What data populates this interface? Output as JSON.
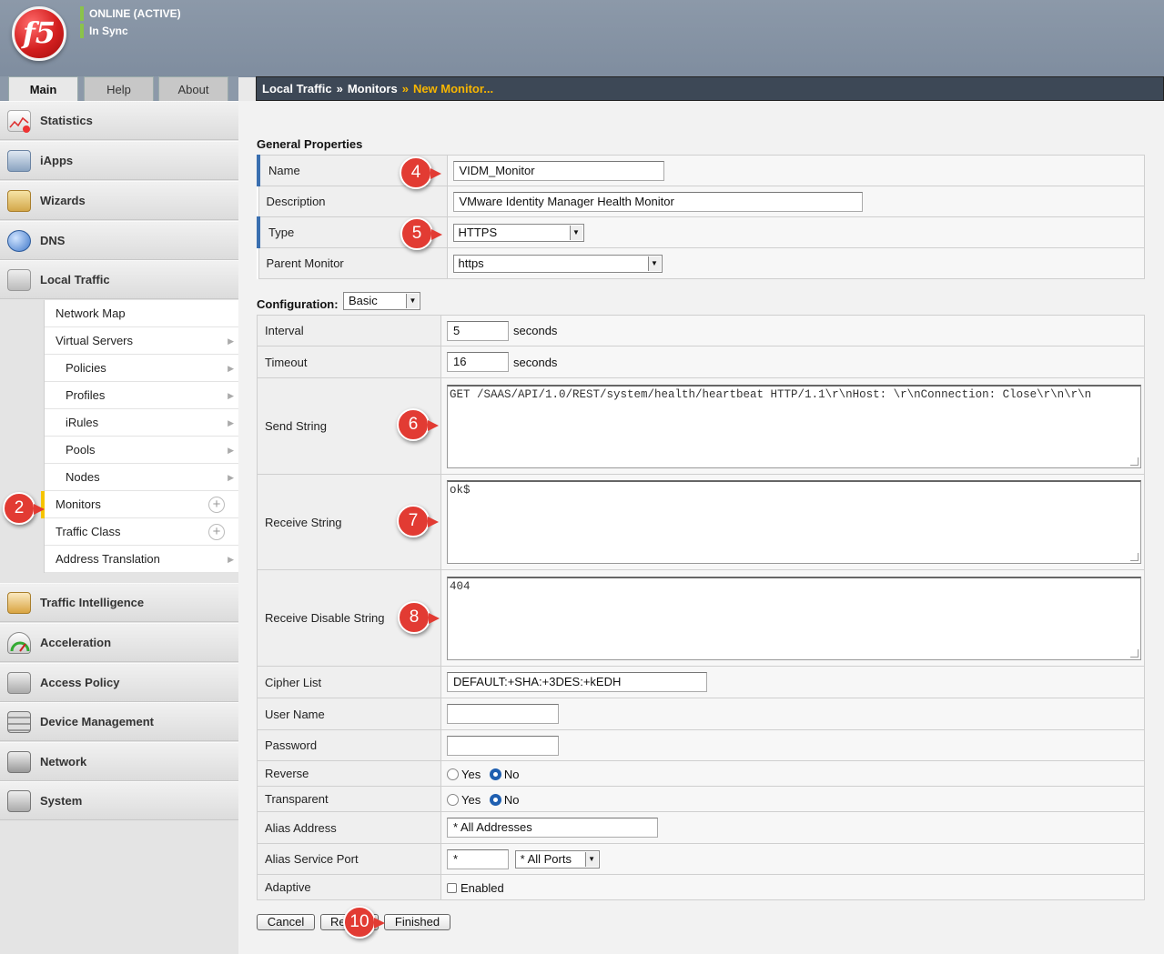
{
  "header": {
    "logo": "f5",
    "status_online": "ONLINE (ACTIVE)",
    "status_sync": "In Sync"
  },
  "tabs": [
    "Main",
    "Help",
    "About"
  ],
  "breadcrumb": {
    "items": [
      "Local Traffic",
      "Monitors"
    ],
    "current": "New Monitor..."
  },
  "sidebar": {
    "items": [
      {
        "label": "Statistics",
        "icon": "statistics-icon"
      },
      {
        "label": "iApps",
        "icon": "iapps-icon"
      },
      {
        "label": "Wizards",
        "icon": "wizards-icon"
      },
      {
        "label": "DNS",
        "icon": "dns-globe-icon"
      },
      {
        "label": "Local Traffic",
        "icon": "local-traffic-icon"
      },
      {
        "label": "Traffic Intelligence",
        "icon": "traffic-intelligence-icon"
      },
      {
        "label": "Acceleration",
        "icon": "acceleration-gauge-icon"
      },
      {
        "label": "Access Policy",
        "icon": "access-policy-icon"
      },
      {
        "label": "Device Management",
        "icon": "device-management-icon"
      },
      {
        "label": "Network",
        "icon": "network-icon"
      },
      {
        "label": "System",
        "icon": "system-icon"
      }
    ],
    "submenu": [
      {
        "label": "Network Map"
      },
      {
        "label": "Virtual Servers"
      },
      {
        "label": "Policies"
      },
      {
        "label": "Profiles"
      },
      {
        "label": "iRules"
      },
      {
        "label": "Pools"
      },
      {
        "label": "Nodes"
      },
      {
        "label": "Monitors"
      },
      {
        "label": "Traffic Class"
      },
      {
        "label": "Address Translation"
      }
    ]
  },
  "general": {
    "title": "General Properties",
    "name_label": "Name",
    "name_value": "VIDM_Monitor",
    "description_label": "Description",
    "description_value": "VMware Identity Manager Health Monitor",
    "type_label": "Type",
    "type_value": "HTTPS",
    "parent_label": "Parent Monitor",
    "parent_value": "https"
  },
  "configuration": {
    "title": "Configuration:",
    "mode": "Basic",
    "interval_label": "Interval",
    "interval_value": "5",
    "timeout_label": "Timeout",
    "timeout_value": "16",
    "seconds": "seconds",
    "send_label": "Send String",
    "send_value": "GET /SAAS/API/1.0/REST/system/health/heartbeat HTTP/1.1\\r\\nHost: \\r\\nConnection: Close\\r\\n\\r\\n",
    "receive_label": "Receive String",
    "receive_value": "ok$",
    "receive_disable_label": "Receive Disable String",
    "receive_disable_value": "404",
    "cipher_label": "Cipher List",
    "cipher_value": "DEFAULT:+SHA:+3DES:+kEDH",
    "username_label": "User Name",
    "username_value": "",
    "password_label": "Password",
    "password_value": "",
    "reverse_label": "Reverse",
    "transparent_label": "Transparent",
    "yes": "Yes",
    "no": "No",
    "alias_address_label": "Alias Address",
    "alias_address_value": "* All Addresses",
    "alias_port_label": "Alias Service Port",
    "alias_port_value": "*",
    "alias_port_select": "* All Ports",
    "adaptive_label": "Adaptive",
    "adaptive_option": "Enabled"
  },
  "buttons": {
    "cancel": "Cancel",
    "repeat": "Repeat",
    "finished": "Finished"
  },
  "callouts": [
    "2",
    "4",
    "5",
    "6",
    "7",
    "8",
    "10"
  ]
}
